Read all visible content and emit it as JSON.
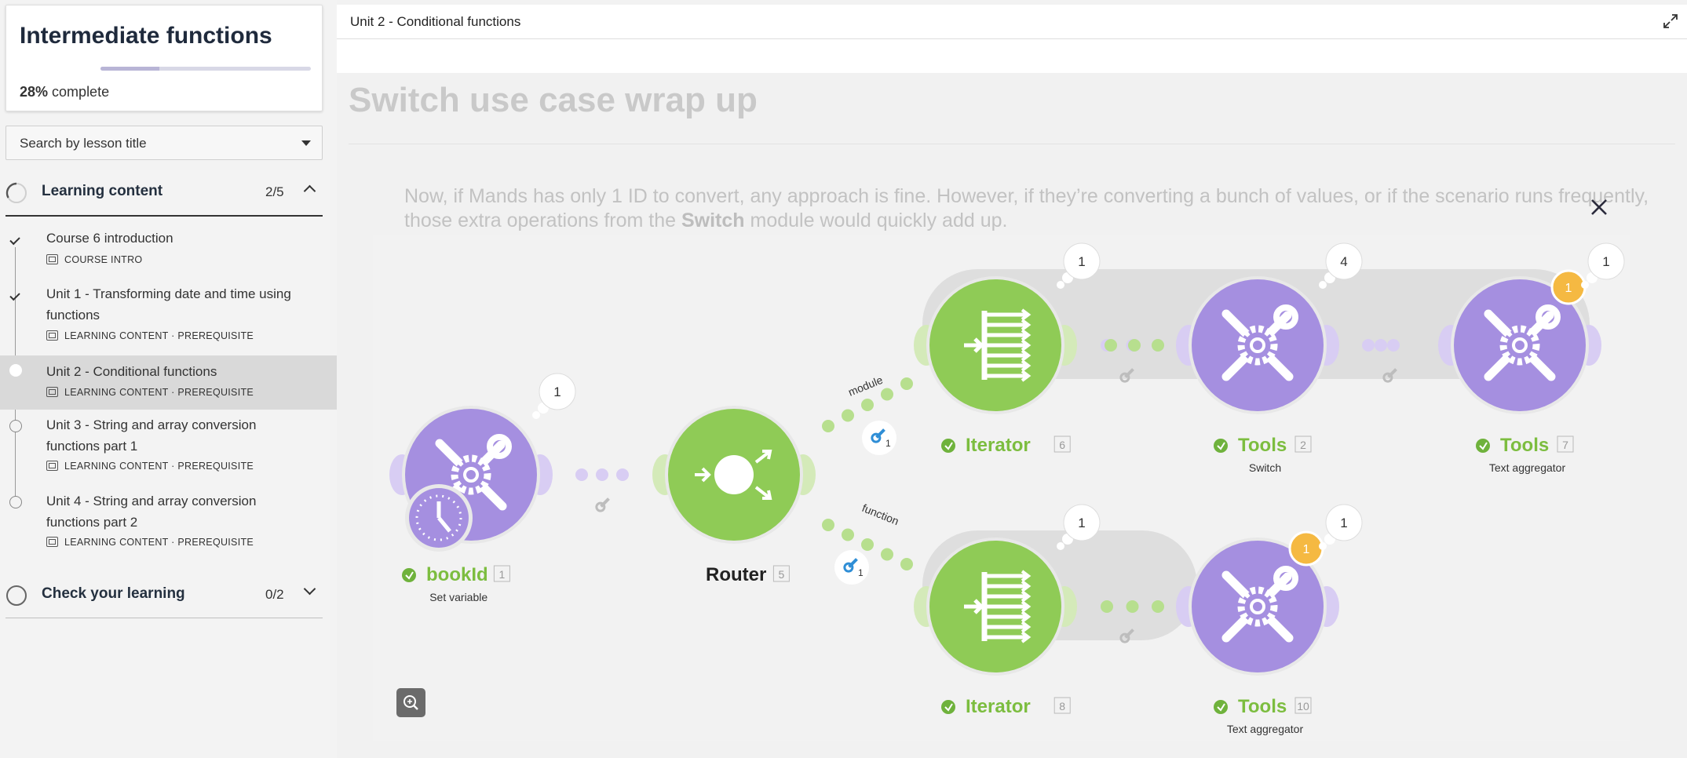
{
  "sidebar": {
    "course_title": "Intermediate functions",
    "progress_percent": "28%",
    "progress_label": "complete",
    "progress_value": 0.28,
    "search_placeholder": "Search by lesson title",
    "sections": [
      {
        "title": "Learning content",
        "count": "2/5",
        "lessons": [
          {
            "title": "Course 6 introduction",
            "meta": "COURSE INTRO",
            "state": "done"
          },
          {
            "title": "Unit 1 - Transforming date and time using functions",
            "meta": "LEARNING CONTENT · PREREQUISITE",
            "state": "done"
          },
          {
            "title": "Unit 2 - Conditional functions",
            "meta": "LEARNING CONTENT · PREREQUISITE",
            "state": "active"
          },
          {
            "title": "Unit 3 - String and array conversion functions part 1",
            "meta": "LEARNING CONTENT · PREREQUISITE",
            "state": "todo"
          },
          {
            "title": "Unit 4 - String and array conversion functions part 2",
            "meta": "LEARNING CONTENT · PREREQUISITE",
            "state": "todo"
          }
        ]
      },
      {
        "title": "Check your learning",
        "count": "0/2"
      }
    ]
  },
  "main": {
    "topbar_title": "Unit 2 - Conditional functions",
    "lesson_heading": "Switch use case wrap up",
    "paragraph_pre": "Now, if Mands has only 1 ID to convert, any approach is fine. However, if they’re converting a bunch of values, or if the scenario runs frequently, those extra operations from the ",
    "paragraph_bold": "Switch",
    "paragraph_post": " module would quickly add up."
  },
  "diagram": {
    "colors": {
      "green": "#8fcb56",
      "purple": "#a58fe0",
      "orange": "#f5b942",
      "green_light": "#d4eab9",
      "purple_light": "#d8cdf3"
    },
    "nodes": {
      "bookid": {
        "name": "bookId",
        "id": "1",
        "sub": "Set variable",
        "bubble": "1"
      },
      "router": {
        "name": "Router",
        "id": "5"
      },
      "iter1": {
        "name": "Iterator",
        "id": "6",
        "bubble": "1"
      },
      "tools2": {
        "name": "Tools",
        "id": "2",
        "sub": "Switch",
        "bubble": "4"
      },
      "tools7": {
        "name": "Tools",
        "id": "7",
        "sub": "Text aggregator",
        "bubble": "1",
        "badge": "1"
      },
      "iter8": {
        "name": "Iterator",
        "id": "8",
        "bubble": "1"
      },
      "tools10": {
        "name": "Tools",
        "id": "10",
        "sub": "Text aggregator",
        "bubble": "1",
        "badge": "1"
      }
    },
    "route_labels": {
      "top": "module",
      "bottom": "function"
    },
    "filter_counts": {
      "top": "1",
      "bottom": "1"
    }
  }
}
